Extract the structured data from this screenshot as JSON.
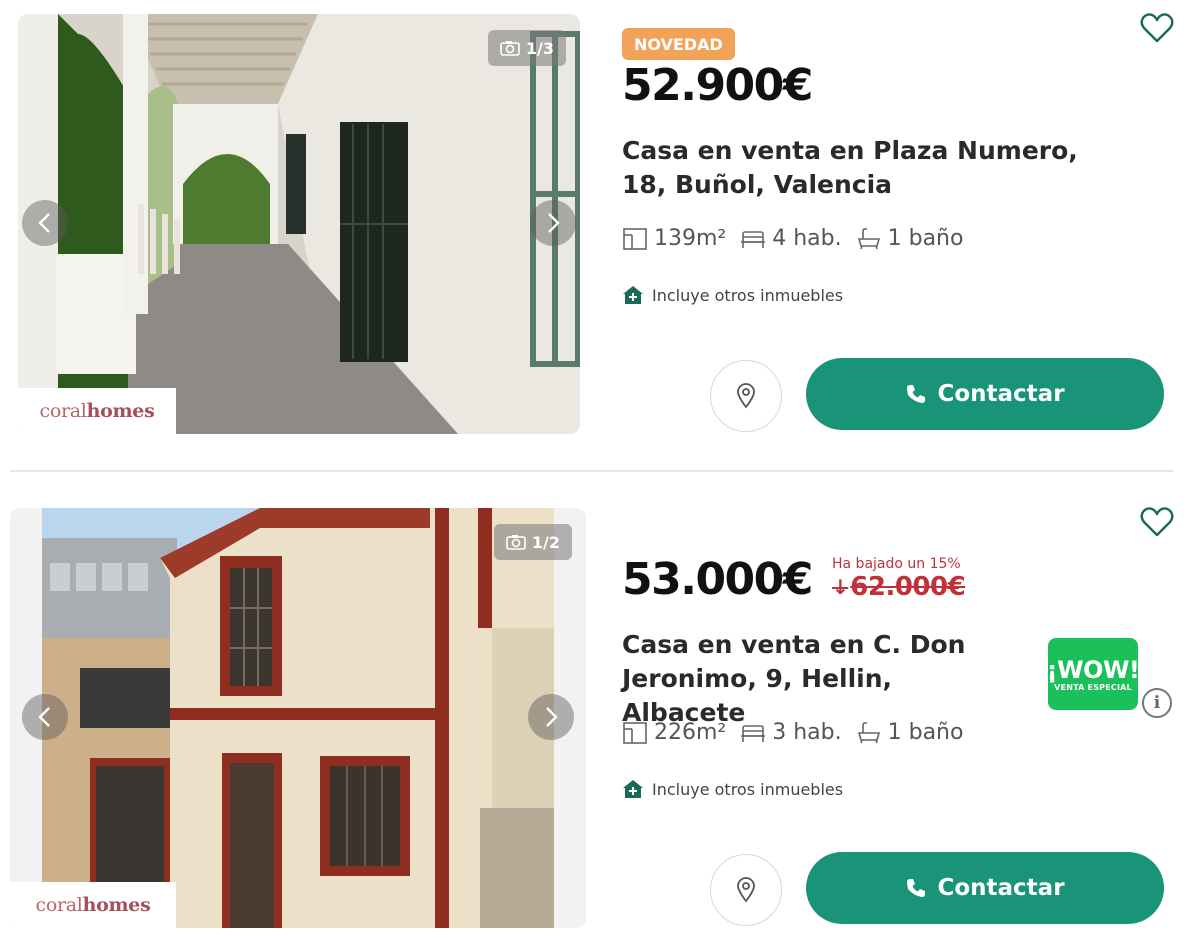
{
  "listings": [
    {
      "photo_counter": "1/3",
      "brand": {
        "prefix": "coral",
        "suffix": "homes"
      },
      "badge": "NOVEDAD",
      "price": "52.900€",
      "title": "Casa en venta en Plaza Numero, 18, Buñol, Valencia",
      "features": {
        "area": "139m²",
        "rooms": "4 hab.",
        "baths": "1 baño"
      },
      "includes": "Incluye otros inmuebles",
      "contact_label": "Contactar"
    },
    {
      "photo_counter": "1/2",
      "brand": {
        "prefix": "coral",
        "suffix": "homes"
      },
      "price": "53.000€",
      "price_drop": {
        "label": "Ha bajado un 15%",
        "old_price": "62.000€",
        "arrow": "↓"
      },
      "title": "Casa en venta en C. Don Jeronimo, 9, Hellin, Albacete",
      "features": {
        "area": "226m²",
        "rooms": "3 hab.",
        "baths": "1 baño"
      },
      "includes": "Incluye otros inmuebles",
      "contact_label": "Contactar",
      "wow": {
        "main": "¡WOW!",
        "sub": "VENTA ESPECIAL"
      },
      "info_icon": "i"
    }
  ],
  "colors": {
    "accent": "#1a9478",
    "badge": "#f2a35a",
    "price_drop": "#c0313b",
    "wow": "#1bc05a"
  }
}
